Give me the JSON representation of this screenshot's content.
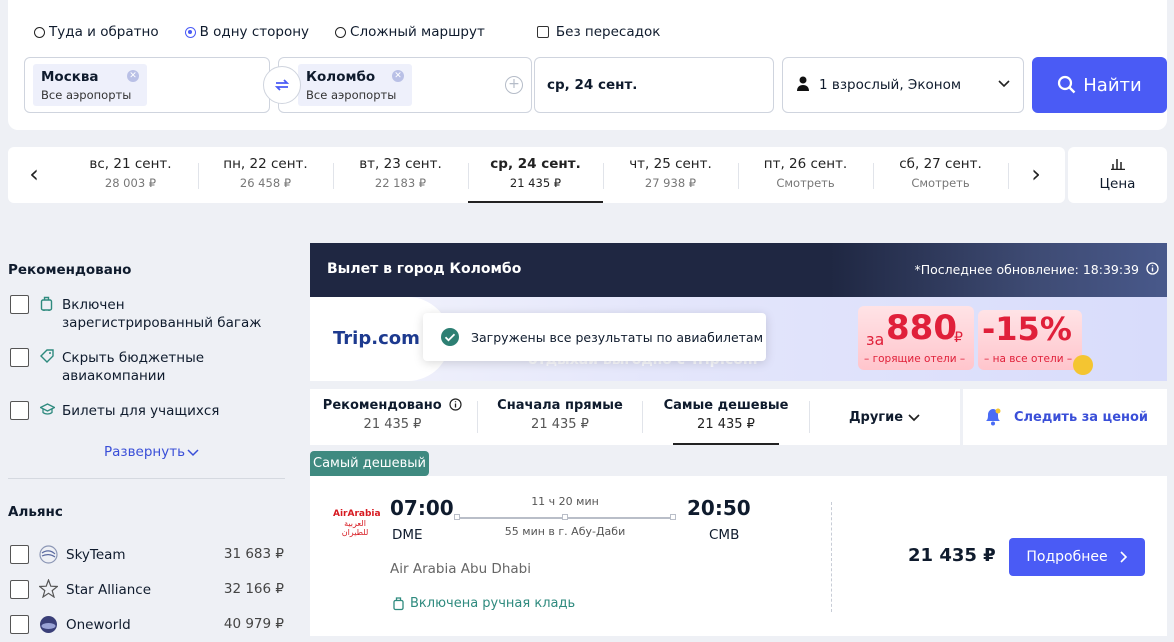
{
  "search": {
    "trip_types": [
      "Туда и обратно",
      "В одну сторону",
      "Сложный маршрут"
    ],
    "selected_trip": 1,
    "direct_only_label": "Без пересадок",
    "from": {
      "city": "Москва",
      "airports": "Все аэропорты"
    },
    "to": {
      "city": "Коломбо",
      "airports": "Все аэропорты"
    },
    "date": "ср, 24 сент.",
    "passengers": "1 взрослый, Эконом",
    "find_label": "Найти"
  },
  "dates": [
    {
      "day": "вс, 21 сент.",
      "price": "28 003 ₽"
    },
    {
      "day": "пн, 22 сент.",
      "price": "26 458 ₽"
    },
    {
      "day": "вт, 23 сент.",
      "price": "22 183 ₽"
    },
    {
      "day": "ср, 24 сент.",
      "price": "21 435 ₽"
    },
    {
      "day": "чт, 25 сент.",
      "price": "27 938 ₽"
    },
    {
      "day": "пт, 26 сент.",
      "price": "Смотреть"
    },
    {
      "day": "сб, 27 сент.",
      "price": "Смотреть"
    }
  ],
  "price_toggle_label": "Цена",
  "sidebar": {
    "recommended_title": "Рекомендовано",
    "filters": [
      {
        "label": "Включен зарегистрированный багаж"
      },
      {
        "label": "Скрыть бюджетные авиакомпании"
      },
      {
        "label": "Билеты для учащихся"
      }
    ],
    "expand_label": "Развернуть",
    "alliance_title": "Альянс",
    "alliances": [
      {
        "name": "SkyTeam",
        "price": "31 683 ₽"
      },
      {
        "name": "Star Alliance",
        "price": "32 166 ₽"
      },
      {
        "name": "Oneworld",
        "price": "40 979 ₽"
      }
    ]
  },
  "results_header": {
    "title": "Вылет в город Коломбо",
    "updated": "*Последнее обновление: 18:39:39"
  },
  "ad": {
    "brand": "Trip.com",
    "tagline": "отдыхай выгодно с Trip.com",
    "offer1_prefix": "за",
    "offer1_value": "880",
    "offer1_currency": "₽",
    "offer1_caption": "– горящие отели –",
    "offer2_value": "-15%",
    "offer2_caption": "– на все отели –"
  },
  "toast": "Загружены все результаты по авиабилетам",
  "sort_tabs": [
    {
      "label": "Рекомендовано",
      "price": "21 435 ₽"
    },
    {
      "label": "Сначала прямые",
      "price": "21 435 ₽"
    },
    {
      "label": "Самые дешевые",
      "price": "21 435 ₽"
    }
  ],
  "other_label": "Другие",
  "follow_label": "Следить за ценой",
  "cheapest_badge": "Самый дешевый",
  "ticket": {
    "airline_logo_text": "AirArabia",
    "airline_logo_arabic": "العربية للطيران",
    "dep_time": "07:00",
    "dep_airport": "DME",
    "duration": "11 ч 20 мин",
    "stopover": "55 мин в г. Абу-Даби",
    "arr_time": "20:50",
    "arr_airport": "CMB",
    "airline": "Air Arabia Abu Dhabi",
    "baggage": "Включена ручная кладь",
    "price": "21 435 ₽",
    "details_label": "Подробнее"
  }
}
